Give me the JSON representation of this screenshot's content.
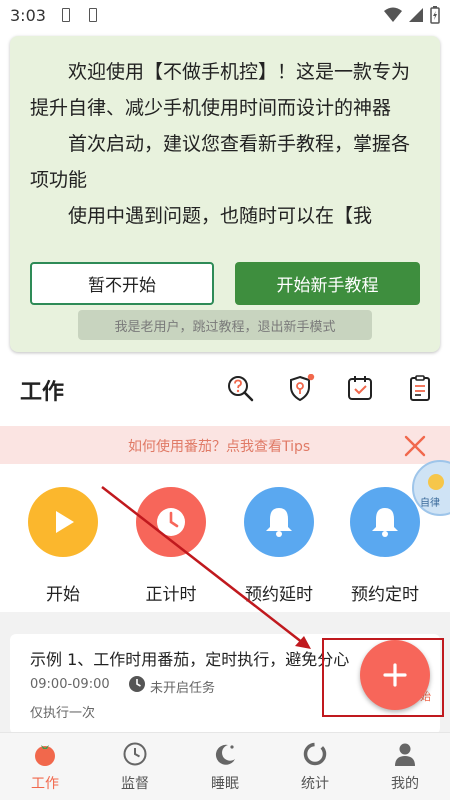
{
  "status_bar": {
    "time": "3:03"
  },
  "welcome": {
    "paragraphs": [
      "欢迎使用【不做手机控】！这是一款专为提升自律、减少手机使用时间而设计的神器",
      "首次启动，建议您查看新手教程，掌握各项功能",
      "使用中遇到问题，也随时可以在【我"
    ],
    "skip_button": "暂不开始",
    "start_button": "开始新手教程",
    "old_user_button": "我是老用户，跳过教程，退出新手模式"
  },
  "section": {
    "title": "工作",
    "icons": [
      "search-question-icon",
      "shield-key-icon",
      "calendar-check-icon",
      "clipboard-list-icon"
    ]
  },
  "tips": {
    "text": "如何使用番茄？点我查看Tips"
  },
  "float_badge": {
    "text": "自律"
  },
  "actions": [
    {
      "label": "开始",
      "color": "#fbb72d",
      "icon": "play-icon"
    },
    {
      "label": "正计时",
      "color": "#f7665a",
      "icon": "clock-icon"
    },
    {
      "label": "预约延时",
      "color": "#5aa8f0",
      "icon": "bell-icon"
    },
    {
      "label": "预约定时",
      "color": "#5aa8f0",
      "icon": "bell-icon"
    }
  ],
  "task": {
    "title": "示例 1、工作时用番茄，定时执行，避免分心",
    "time_range": "09:00-09:00",
    "status": "未开启任务",
    "repeat": "仅执行一次",
    "tag": "始"
  },
  "nav": [
    {
      "label": "工作",
      "active": true,
      "icon": "tomato-icon"
    },
    {
      "label": "监督",
      "active": false,
      "icon": "clock-icon"
    },
    {
      "label": "睡眠",
      "active": false,
      "icon": "moon-icon"
    },
    {
      "label": "统计",
      "active": false,
      "icon": "ring-chart-icon"
    },
    {
      "label": "我的",
      "active": false,
      "icon": "user-icon"
    }
  ],
  "colors": {
    "accent": "#f1684c",
    "green_primary": "#3e8e3e",
    "card_bg": "#e8f2dd",
    "highlight": "#c0191e"
  }
}
